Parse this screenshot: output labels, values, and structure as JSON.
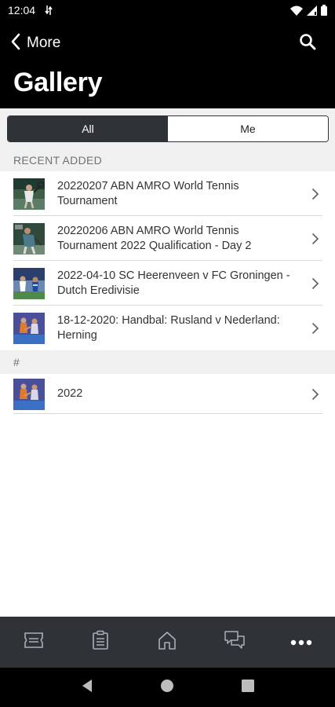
{
  "status_bar": {
    "time": "12:04",
    "icons": [
      "data-transfer-icon",
      "wifi-icon",
      "signal-icon",
      "battery-icon"
    ]
  },
  "header": {
    "back_label": "More",
    "title": "Gallery",
    "search_icon": "search-icon"
  },
  "segments": [
    {
      "label": "All",
      "active": true
    },
    {
      "label": "Me",
      "active": false
    }
  ],
  "sections": [
    {
      "title": "RECENT ADDED",
      "items": [
        {
          "label": "20220207 ABN AMRO World Tennis Tournament",
          "thumb": "tennis-photo"
        },
        {
          "label": "20220206 ABN AMRO World Tennis Tournament 2022 Qualification - Day 2",
          "thumb": "tennis-photo"
        },
        {
          "label": "2022-04-10 SC Heerenveen v FC Groningen - Dutch Eredivisie",
          "thumb": "football-photo"
        },
        {
          "label": "18-12-2020: Handbal: Rusland v Nederland: Herning",
          "thumb": "handball-photo"
        }
      ]
    },
    {
      "title": "#",
      "items": [
        {
          "label": "2022",
          "thumb": "handball-photo"
        }
      ]
    }
  ],
  "tab_bar": {
    "tabs": [
      "ticket-icon",
      "clipboard-icon",
      "home-icon",
      "chat-icon",
      "more-icon"
    ],
    "active": "more-icon"
  },
  "nav_bar": [
    "back-icon",
    "home-icon",
    "recents-icon"
  ],
  "colors": {
    "header_bg": "#000000",
    "segment_active": "#2f3338",
    "tab_bar_bg": "#2f3338",
    "section_bg": "#f0f0f0"
  }
}
